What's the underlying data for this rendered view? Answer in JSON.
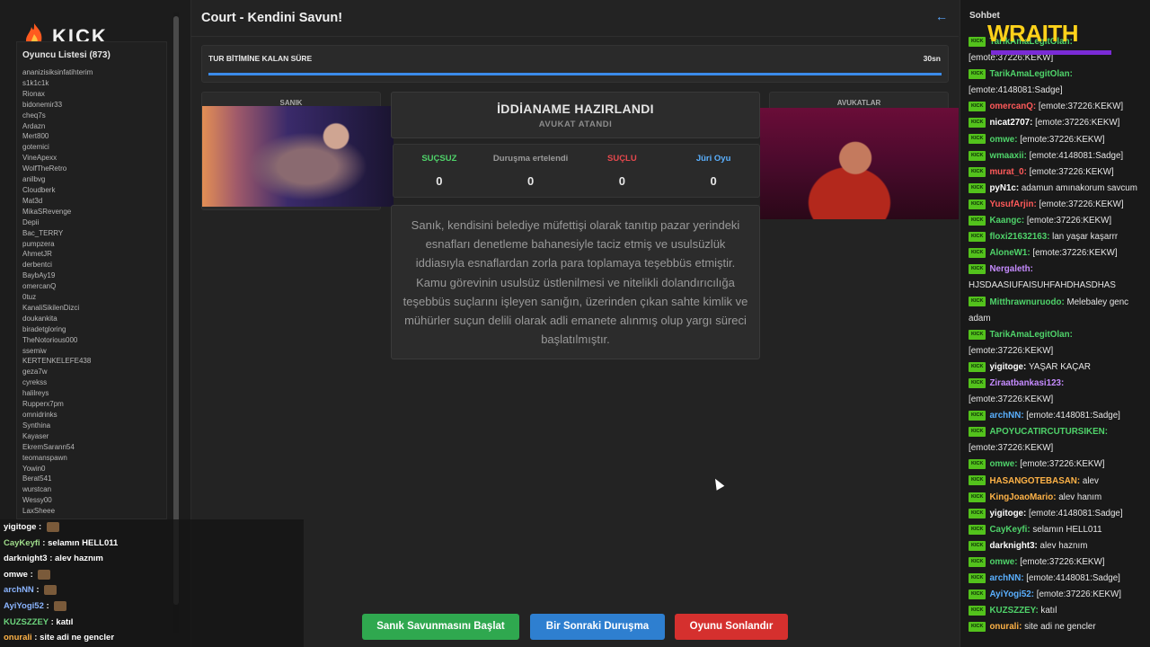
{
  "logo": {
    "text": "KICK"
  },
  "player_list": {
    "title": "Oyuncu Listesi (873)",
    "players": [
      "ananizisiksinfatihterim",
      "s1k1c1k",
      "Rionax",
      "bidonemir33",
      "cheq7s",
      "Ardazn",
      "Mert800",
      "gotemici",
      "VineApexx",
      "WolfTheRetro",
      "anilbvg",
      "Cloudberk",
      "Mat3d",
      "MikaSRevenge",
      "Depii",
      "Bac_TERRY",
      "pumpzera",
      "AhmetJR",
      "derbentci",
      "BaybAy19",
      "omercanQ",
      "0tuz",
      "KanaliSikilenDizci",
      "doukankita",
      "biradetgloring",
      "TheNotorious000",
      "ssemiw",
      "KERTENKELEFE438",
      "geza7w",
      "cyrekss",
      "halilreys",
      "Rupperx7pm",
      "omnidrinks",
      "Synthina",
      "Kayaser",
      "EkremSarann54",
      "teomanspawn",
      "Yowin0",
      "Berat541",
      "wurstcan",
      "Wessy00",
      "LaxSheee"
    ]
  },
  "overlay_chat": [
    {
      "user": "yigitoge",
      "color": "#ffffff",
      "text": "",
      "emote": true
    },
    {
      "user": "CayKeyfi",
      "color": "#9fdc8a",
      "text": "selamın HELL011",
      "emote": false
    },
    {
      "user": "darknight3",
      "color": "#ffffff",
      "text": "alev haznım",
      "emote": false
    },
    {
      "user": "omwe",
      "color": "#ffffff",
      "text": "",
      "emote": true
    },
    {
      "user": "archNN",
      "color": "#8ab4ff",
      "text": "",
      "emote": true
    },
    {
      "user": "AyiYogi52",
      "color": "#8ab4ff",
      "text": "",
      "emote": true
    },
    {
      "user": "KUZSZZEY",
      "color": "#6cd37c",
      "text": "katıl",
      "emote": false
    },
    {
      "user": "onurali",
      "color": "#ffb347",
      "text": "site adi ne gencler",
      "emote": false
    }
  ],
  "header": {
    "title": "Court - Kendini Savun!",
    "back_icon": "arrow-left-icon"
  },
  "timer": {
    "label": "TUR BİTİMİNE KALAN SÜRE",
    "value": "30sn",
    "progress": 1.0
  },
  "panels": {
    "left_label": "SANIK",
    "right_label": "AVUKATLAR"
  },
  "status_card": {
    "title": "İDDİANAME HAZIRLANDI",
    "subtitle": "AVUKAT ATANDI"
  },
  "votes": [
    {
      "label": "SUÇSUZ",
      "count": "0",
      "color": "#4fd36a"
    },
    {
      "label": "Duruşma ertelendi",
      "count": "0",
      "color": "#9a9a9a"
    },
    {
      "label": "SUÇLU",
      "count": "0",
      "color": "#e5484d"
    },
    {
      "label": "Jüri Oyu",
      "count": "0",
      "color": "#5ab0ff"
    }
  ],
  "indictment": {
    "text": "Sanık, kendisini belediye müfettişi olarak tanıtıp pazar yerindeki esnafları denetleme bahanesiyle taciz etmiş ve usulsüzlük iddiasıyla esnaflardan zorla para toplamaya teşebbüs etmiştir. Kamu görevinin usulsüz üstlenilmesi ve nitelikli dolandırıcılığa teşebbüs suçlarını işleyen sanığın, üzerinden çıkan sahte kimlik ve mühürler suçun delili olarak adli emanete alınmış olup yargı süreci başlatılmıştır."
  },
  "buttons": {
    "start_defense": "Sanık Savunmasını Başlat",
    "next_trial": "Bir Sonraki Duruşma",
    "end_game": "Oyunu Sonlandır"
  },
  "sidebar_chat": {
    "title": "Sohbet",
    "overlay_logo": "WRAITH",
    "badge": "KICK",
    "messages": [
      {
        "user": "TarikAmaLegitOlan",
        "color": "#4fd36a",
        "text": "[emote:37226:KEKW]"
      },
      {
        "user": "TarikAmaLegitOlan",
        "color": "#4fd36a",
        "text": "[emote:4148081:Sadge]"
      },
      {
        "user": "omercanQ",
        "color": "#ff5a5a",
        "text": "[emote:37226:KEKW]"
      },
      {
        "user": "nicat2707",
        "color": "#ffffff",
        "text": "[emote:37226:KEKW]"
      },
      {
        "user": "omwe",
        "color": "#4fd36a",
        "text": "[emote:37226:KEKW]"
      },
      {
        "user": "wmaaxii",
        "color": "#4fd36a",
        "text": "[emote:4148081:Sadge]"
      },
      {
        "user": "murat_0",
        "color": "#ff5a5a",
        "text": "[emote:37226:KEKW]"
      },
      {
        "user": "pyN1c",
        "color": "#ffffff",
        "text": "adamun amınakorum savcum"
      },
      {
        "user": "YusufArjin",
        "color": "#ff5a5a",
        "text": "[emote:37226:KEKW]"
      },
      {
        "user": "Kaangc",
        "color": "#4fd36a",
        "text": "[emote:37226:KEKW]"
      },
      {
        "user": "floxi21632163",
        "color": "#4fd36a",
        "text": "lan yaşar kaşarrr"
      },
      {
        "user": "AloneW1",
        "color": "#4fd36a",
        "text": "[emote:37226:KEKW]"
      },
      {
        "user": "Nergaleth",
        "color": "#c58bff",
        "text": "HJSDAASIUFAISUHFAHDHASDHAS"
      },
      {
        "user": "Mitthrawnuruodo",
        "color": "#4fd36a",
        "text": "Melebaley genc adam"
      },
      {
        "user": "TarikAmaLegitOlan",
        "color": "#4fd36a",
        "text": "[emote:37226:KEKW]"
      },
      {
        "user": "yigitoge",
        "color": "#ffffff",
        "text": "YAŞAR KAÇAR"
      },
      {
        "user": "Ziraatbankasi123",
        "color": "#c58bff",
        "text": "[emote:37226:KEKW]"
      },
      {
        "user": "archNN",
        "color": "#5ab0ff",
        "text": "[emote:4148081:Sadge]"
      },
      {
        "user": "APOYUCATIRCUTURSIKEN",
        "color": "#4fd36a",
        "text": "[emote:37226:KEKW]"
      },
      {
        "user": "omwe",
        "color": "#4fd36a",
        "text": "[emote:37226:KEKW]"
      },
      {
        "user": "HASANGOTEBASAN",
        "color": "#ffb347",
        "text": "alev"
      },
      {
        "user": "KingJoaoMario",
        "color": "#ffb347",
        "text": "alev hanım"
      },
      {
        "user": "yigitoge",
        "color": "#ffffff",
        "text": "[emote:4148081:Sadge]"
      },
      {
        "user": "CayKeyfi",
        "color": "#4fd36a",
        "text": "selamın HELL011"
      },
      {
        "user": "darknight3",
        "color": "#ffffff",
        "text": "alev haznım"
      },
      {
        "user": "omwe",
        "color": "#4fd36a",
        "text": "[emote:37226:KEKW]"
      },
      {
        "user": "archNN",
        "color": "#5ab0ff",
        "text": "[emote:4148081:Sadge]"
      },
      {
        "user": "AyiYogi52",
        "color": "#5ab0ff",
        "text": "[emote:37226:KEKW]"
      },
      {
        "user": "KUZSZZEY",
        "color": "#4fd36a",
        "text": "katıl"
      },
      {
        "user": "onurali",
        "color": "#ffb347",
        "text": "site adi ne gencler"
      }
    ]
  }
}
